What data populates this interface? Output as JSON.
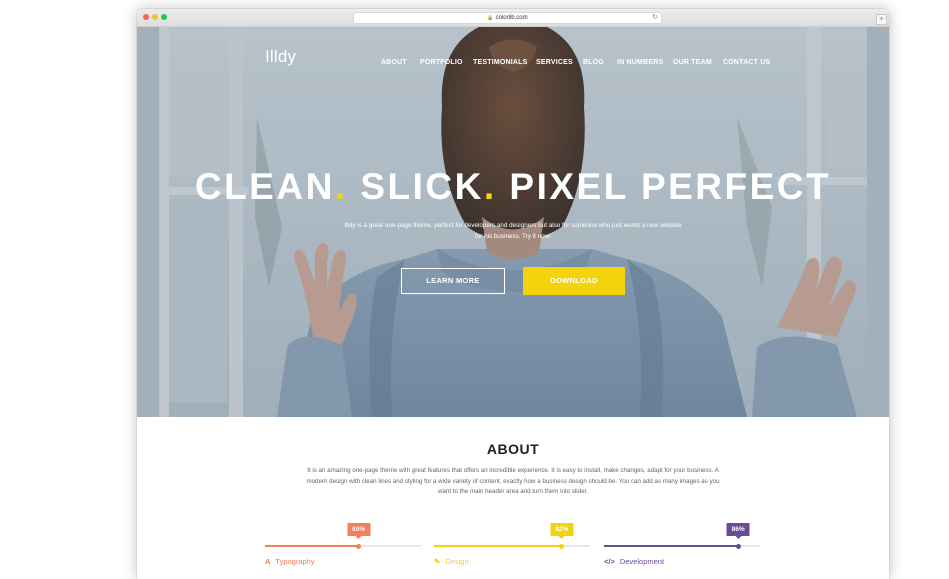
{
  "browser": {
    "url": "colorlib.com"
  },
  "site": {
    "logo": "Illdy",
    "nav": [
      "ABOUT",
      "PORTFOLIO",
      "TESTIMONIALS",
      "SERVICES",
      "BLOG",
      "IN NUMBERS",
      "OUR TEAM",
      "CONTACT US"
    ]
  },
  "hero": {
    "headline_1": "CLEAN",
    "headline_2": "SLICK",
    "headline_3": "PIXEL PERFECT",
    "dot": ".",
    "subtext": "Illdy is a great one-page theme, perfect for developers and designers but also for someone who just wants a new website for his business. Try it now!",
    "learn_more": "LEARN MORE",
    "download": "DOWNLOAD"
  },
  "about": {
    "title": "ABOUT",
    "text": "It is an amazing one-page theme with great features that offers an incredible experience. It is easy to install, make changes, adapt for your business. A modern design with clean lines and styling for a wide variety of content, exactly how a business design should be. You can add as many images as you want to the main header area and turn them into slider."
  },
  "skills": [
    {
      "label": "Typography",
      "badge": "60%",
      "value": 60,
      "color": "#f1805f",
      "icon": "typography-icon"
    },
    {
      "label": "Design",
      "badge": "82%",
      "value": 82,
      "color": "#f3d30b",
      "icon": "pencil-icon"
    },
    {
      "label": "Development",
      "badge": "86%",
      "value": 86,
      "color": "#6a4c93",
      "icon": "code-icon"
    }
  ],
  "colors": {
    "accent_yellow": "#f3d30b",
    "typography_orange": "#f1805f",
    "development_purple": "#6a4c93"
  }
}
